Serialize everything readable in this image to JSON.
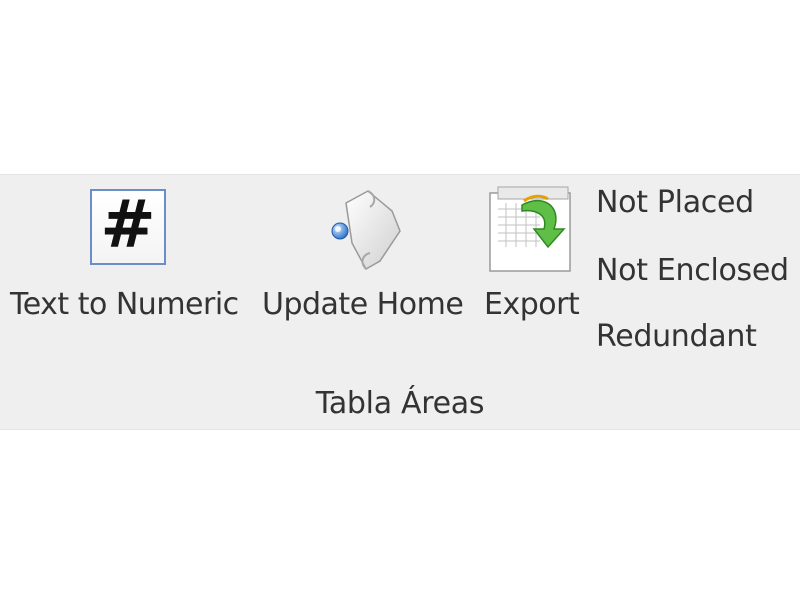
{
  "ribbon": {
    "buttons": [
      {
        "label": "Text to Numeric",
        "icon": "hash-icon",
        "glyph": "#"
      },
      {
        "label": "Update Home",
        "icon": "scroll-update-icon"
      },
      {
        "label": "Export",
        "icon": "export-table-icon"
      }
    ],
    "small_buttons": [
      {
        "label": "Not Placed"
      },
      {
        "label": "Not Enclosed"
      },
      {
        "label": "Redundant"
      }
    ],
    "group_label": "Tabla Áreas"
  }
}
